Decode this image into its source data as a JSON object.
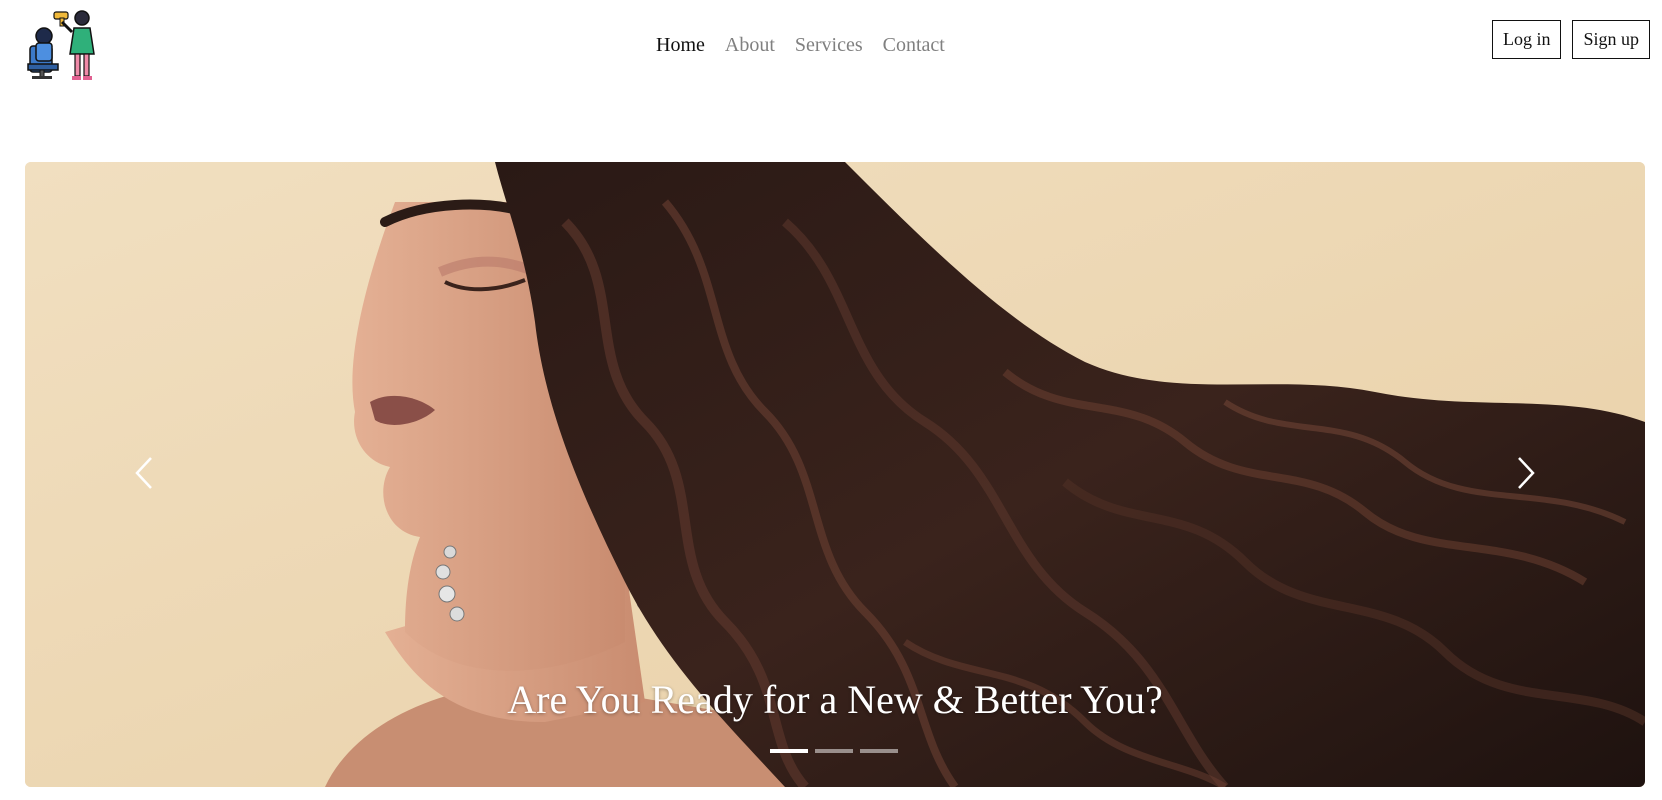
{
  "header": {
    "logo_icon": "hairdresser-styling-client-icon",
    "nav": [
      {
        "label": "Home",
        "active": true
      },
      {
        "label": "About",
        "active": false
      },
      {
        "label": "Services",
        "active": false
      },
      {
        "label": "Contact",
        "active": false
      }
    ],
    "auth": {
      "login_label": "Log in",
      "signup_label": "Sign up"
    }
  },
  "hero": {
    "image": "woman-with-long-wavy-dark-hair-on-beige-background",
    "caption": "Are You Ready for a New & Better You?",
    "prev_icon": "chevron-left-icon",
    "next_icon": "chevron-right-icon",
    "slide_count": 3,
    "active_slide": 1
  },
  "colors": {
    "background": "#ffffff",
    "nav_active": "#111111",
    "nav_inactive": "#808080",
    "hero_backdrop": "#efdcbc",
    "hair": "#2a1a16",
    "caption": "#ffffff"
  }
}
